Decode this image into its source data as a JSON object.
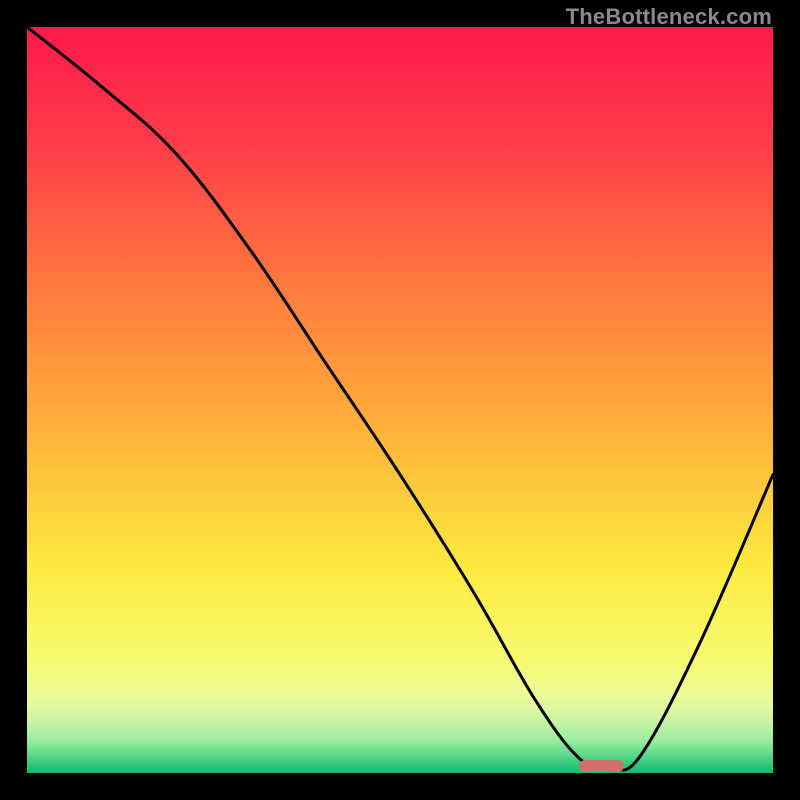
{
  "watermark": "TheBottleneck.com",
  "chart_data": {
    "type": "line",
    "title": "",
    "xlabel": "",
    "ylabel": "",
    "xlim": [
      0,
      100
    ],
    "ylim": [
      0,
      100
    ],
    "series": [
      {
        "name": "bottleneck-curve",
        "x": [
          0,
          10,
          20,
          30,
          40,
          50,
          60,
          68,
          74,
          78,
          82,
          90,
          100
        ],
        "values": [
          100,
          92,
          83,
          70,
          55,
          40,
          24,
          10,
          2,
          1,
          2,
          17,
          40
        ]
      }
    ],
    "optimal_range": {
      "start": 74,
      "end": 80,
      "y": 1
    },
    "gradient_stops": [
      {
        "pos": 0,
        "color": "#ff1a4b"
      },
      {
        "pos": 0.15,
        "color": "#ff3a4a"
      },
      {
        "pos": 0.35,
        "color": "#ff7a3e"
      },
      {
        "pos": 0.55,
        "color": "#ffb43a"
      },
      {
        "pos": 0.72,
        "color": "#fde93e"
      },
      {
        "pos": 0.85,
        "color": "#f8fb70"
      },
      {
        "pos": 0.9,
        "color": "#eafb9a"
      },
      {
        "pos": 0.93,
        "color": "#c9f5a5"
      },
      {
        "pos": 0.955,
        "color": "#9ceea0"
      },
      {
        "pos": 0.975,
        "color": "#5fd98b"
      },
      {
        "pos": 0.99,
        "color": "#2fc57a"
      },
      {
        "pos": 1.0,
        "color": "#18b76e"
      }
    ],
    "marker_color": "#d1716e"
  }
}
